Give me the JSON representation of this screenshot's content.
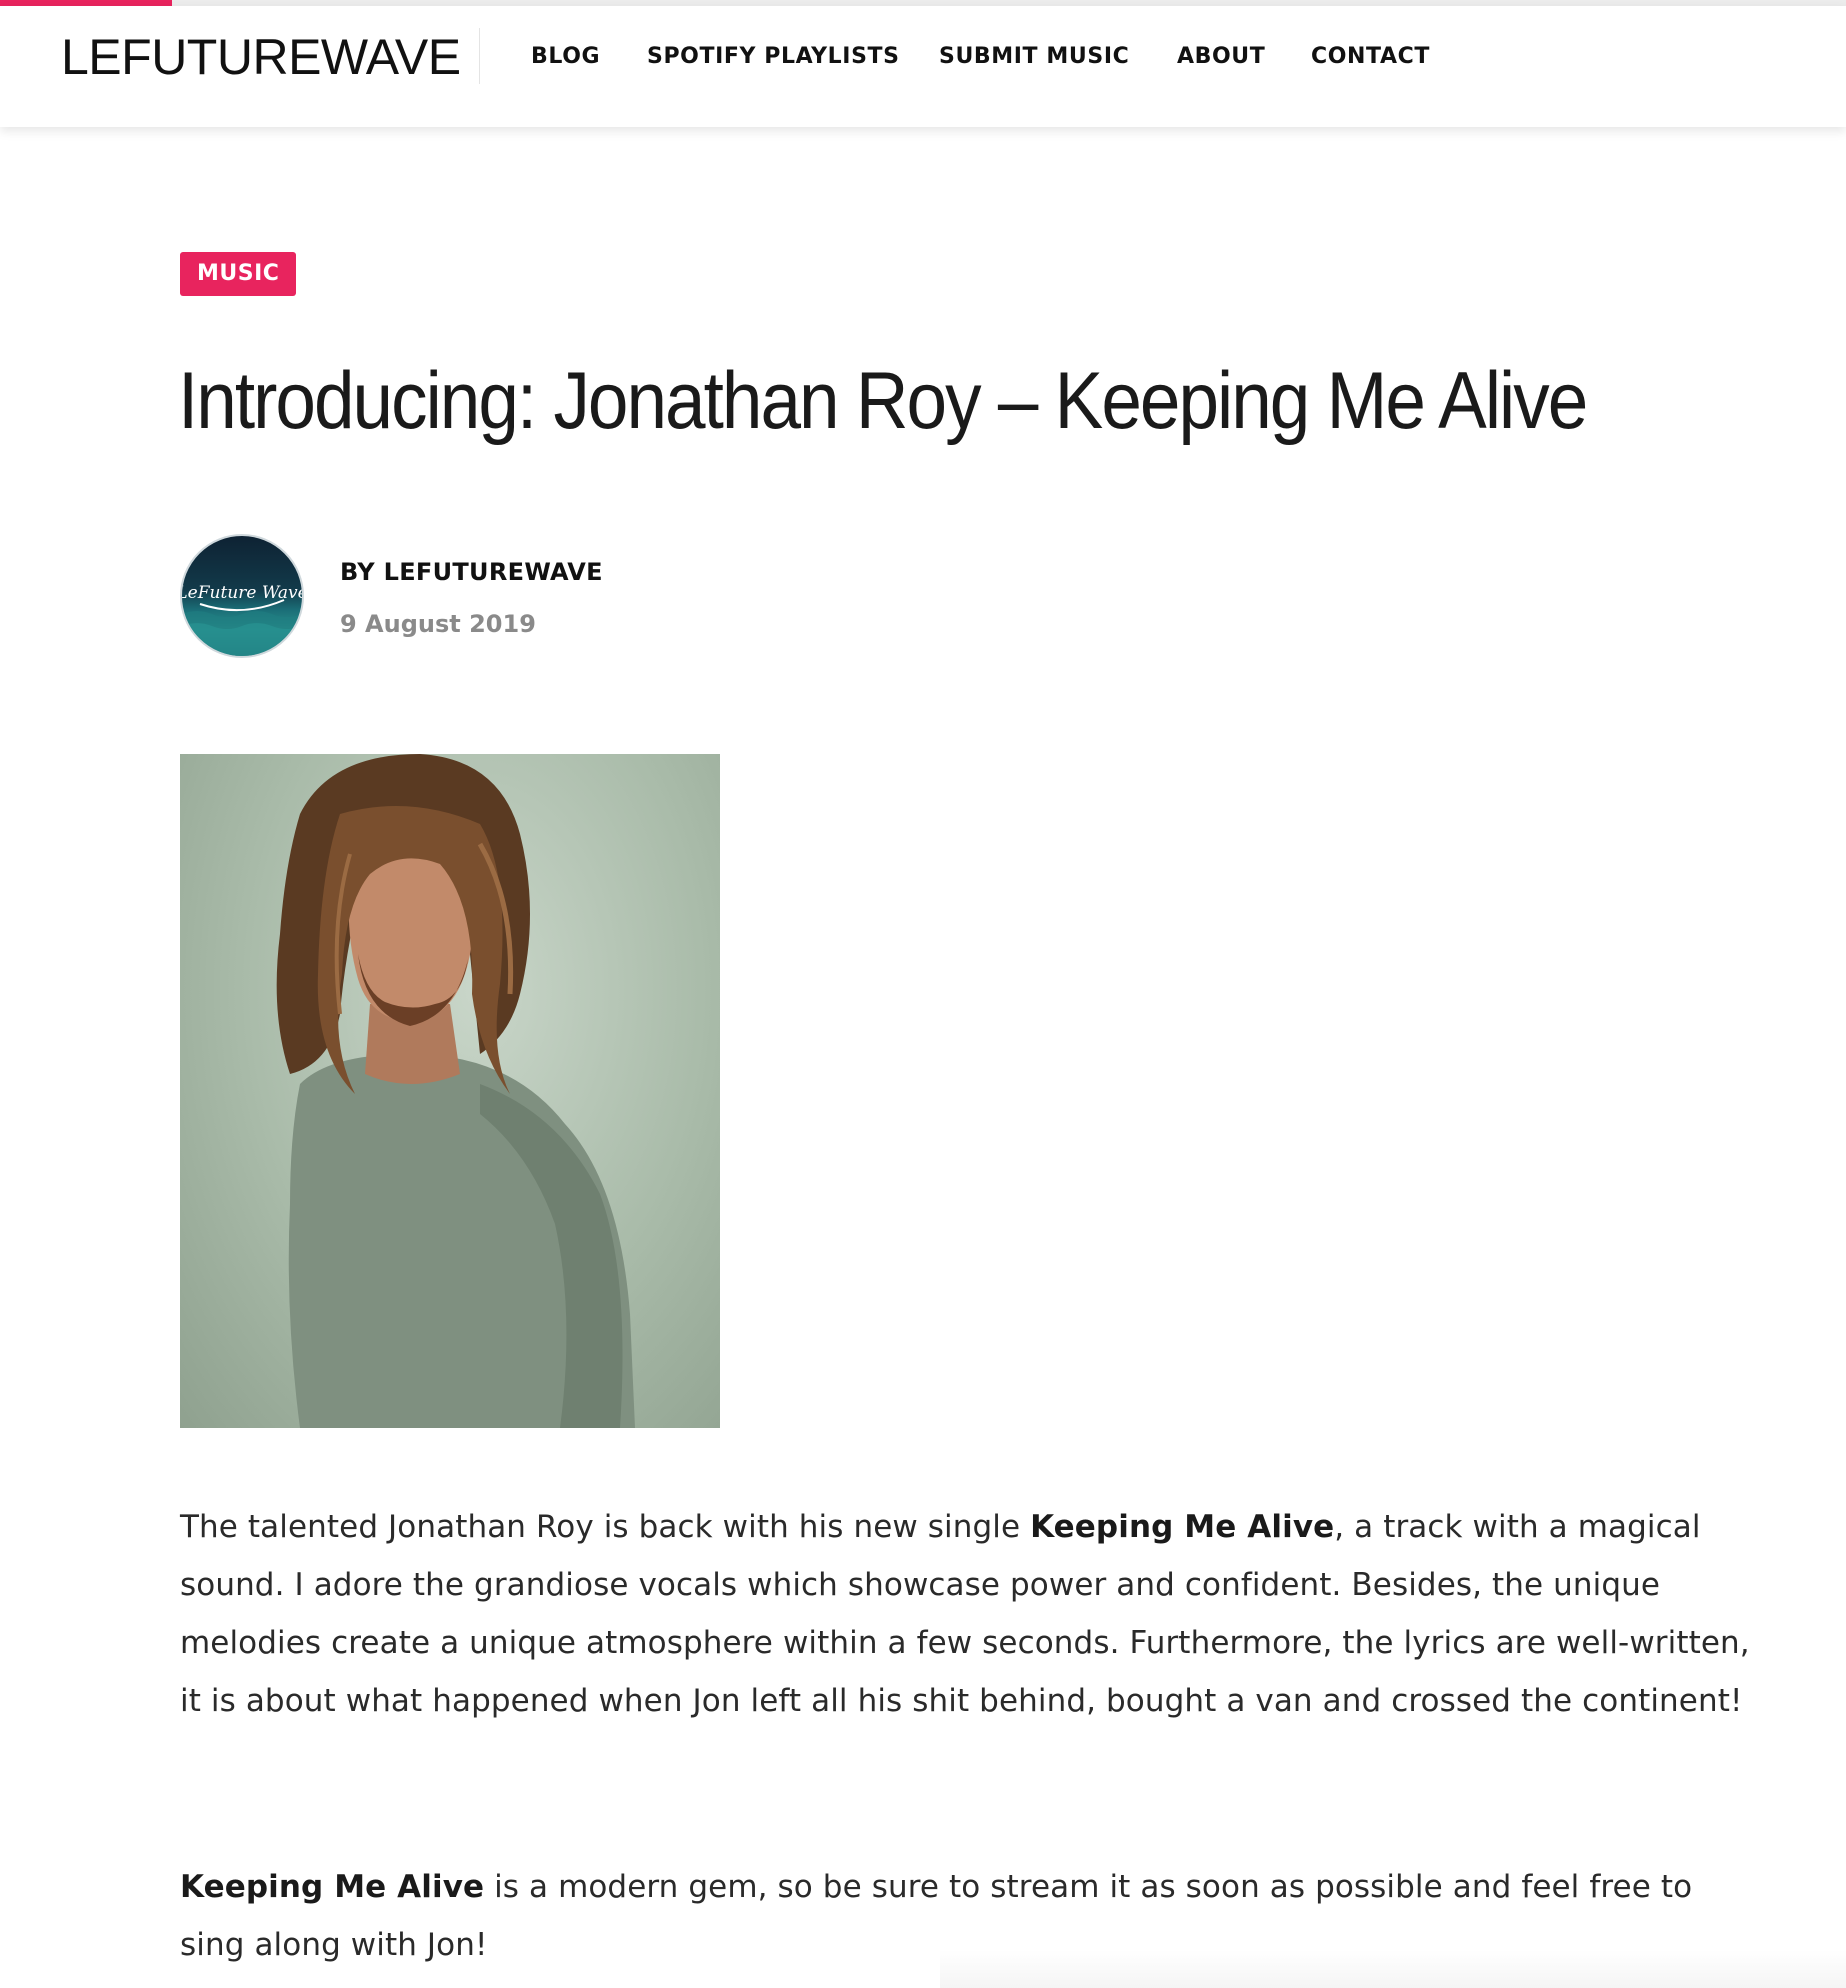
{
  "reading_progress": 0.093,
  "header": {
    "logo": "LEFUTUREWAVE",
    "nav": [
      {
        "label": "BLOG"
      },
      {
        "label": "SPOTIFY PLAYLISTS"
      },
      {
        "label": "SUBMIT MUSIC"
      },
      {
        "label": "ABOUT"
      },
      {
        "label": "CONTACT"
      }
    ]
  },
  "post": {
    "category": "MUSIC",
    "title": "Introducing: Jonathan Roy – Keeping Me Alive",
    "author": "BY LEFUTUREWAVE",
    "date": "9 August 2019",
    "avatar_text": "LeFuture Wave",
    "paragraph1": {
      "intro": "The talented Jonathan Roy is back with his new single ",
      "bold": "Keeping Me Alive",
      "rest": ", a track with a magical sound. I adore the grandiose vocals which showcase power and confident. Besides, the unique melodies create a unique atmosphere within a few seconds. Furthermore, the lyrics are well-written, it is about what happened when Jon left all his shit behind, bought a van and crossed the continent!"
    },
    "paragraph2": {
      "bold": "Keeping Me Alive",
      "rest": " is a modern gem, so be sure to stream it as soon as possible and feel free to sing along with Jon!"
    }
  },
  "colors": {
    "accent": "#e8245e",
    "text": "#222222",
    "muted": "#8a8a8a"
  }
}
